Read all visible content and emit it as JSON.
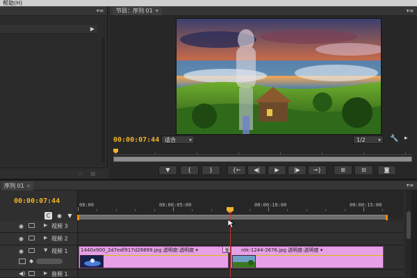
{
  "menubar": {
    "help_label": "帮助(H)"
  },
  "program_monitor": {
    "tab_label": "节目：序列 01",
    "timecode": "00:00:07:44",
    "fit_select": "适合",
    "resolution_select": "1/2"
  },
  "sequence_timeline": {
    "tab_label": "序列 01",
    "timecode": "00:00:07:44",
    "ruler_labels": [
      "00:00",
      "00:00:05:00",
      "00:00:10:00",
      "00:00:15:00"
    ],
    "tracks": [
      {
        "name": "视频 3"
      },
      {
        "name": "视频 2"
      },
      {
        "name": "视频 1"
      },
      {
        "name": "音频 1"
      }
    ],
    "clips": [
      {
        "label": "1440x900_2d7edf917d28899.jpg  透明度:透明度 ▾"
      },
      {
        "label": "渐变擦"
      },
      {
        "label": "ntk-1244-2676.jpg  透明度:透明度 ▾"
      }
    ]
  },
  "colors": {
    "timecode": "#f0b429",
    "clip": "#e7a0e6",
    "playhead": "#c4372a",
    "work_area_end": "#f08a00"
  },
  "icons": {
    "transport": [
      "marker-icon",
      "mark-in-icon",
      "mark-out-icon",
      "go-to-in-icon",
      "step-back-icon",
      "play-icon",
      "step-forward-icon",
      "go-to-out-icon",
      "lift-icon",
      "extract-icon",
      "export-frame-icon"
    ]
  }
}
